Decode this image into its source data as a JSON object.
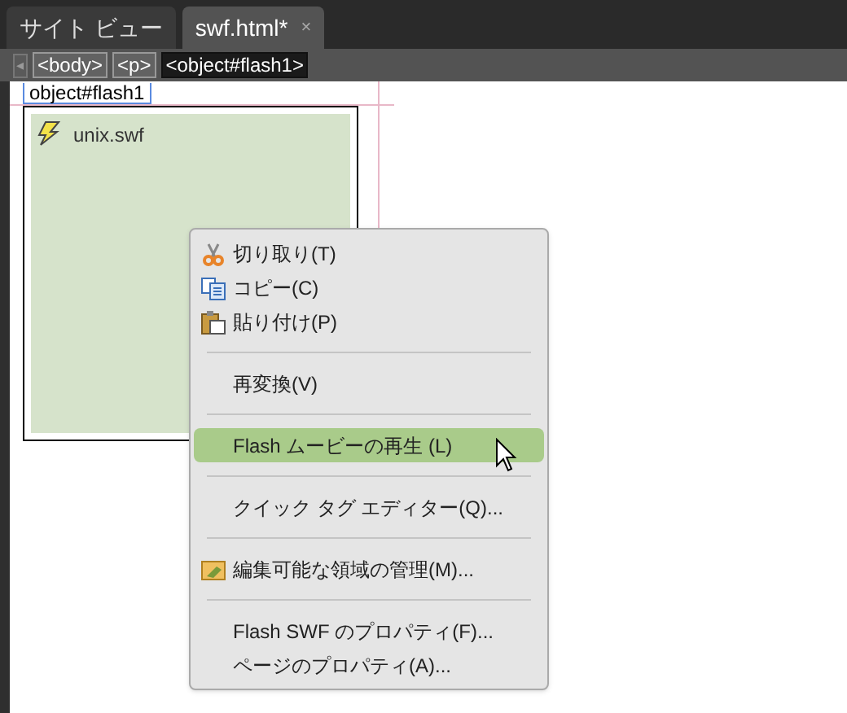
{
  "tabs": [
    {
      "label": "サイト ビュー",
      "selected": false
    },
    {
      "label": "swf.html*",
      "selected": true,
      "close": "×"
    }
  ],
  "tag_selector": {
    "back": "◂",
    "tags": [
      {
        "label": "<body>",
        "selected": false
      },
      {
        "label": "<p>",
        "selected": false
      },
      {
        "label": "<object#flash1>",
        "selected": true
      }
    ]
  },
  "canvas": {
    "object_label": "object#flash1",
    "file_name": "unix.swf"
  },
  "context_menu": [
    {
      "kind": "cut",
      "label": "切り取り(T)",
      "selected": false
    },
    {
      "kind": "copy",
      "label": "コピー(C)",
      "selected": false
    },
    {
      "kind": "paste",
      "label": "貼り付け(P)",
      "selected": false
    },
    {
      "kind": "separator"
    },
    {
      "kind": "plain",
      "label": "再変換(V)",
      "selected": false
    },
    {
      "kind": "separator"
    },
    {
      "kind": "plain",
      "label": "Flash ムービーの再生 (L)",
      "selected": true
    },
    {
      "kind": "separator"
    },
    {
      "kind": "plain",
      "label": "クイック タグ エディター(Q)...",
      "selected": false
    },
    {
      "kind": "separator"
    },
    {
      "kind": "regions",
      "label": "編集可能な領域の管理(M)...",
      "selected": false
    },
    {
      "kind": "separator"
    },
    {
      "kind": "plain",
      "label": "Flash SWF のプロパティ(F)...",
      "selected": false
    },
    {
      "kind": "plain",
      "label": "ページのプロパティ(A)...",
      "selected": false
    }
  ]
}
